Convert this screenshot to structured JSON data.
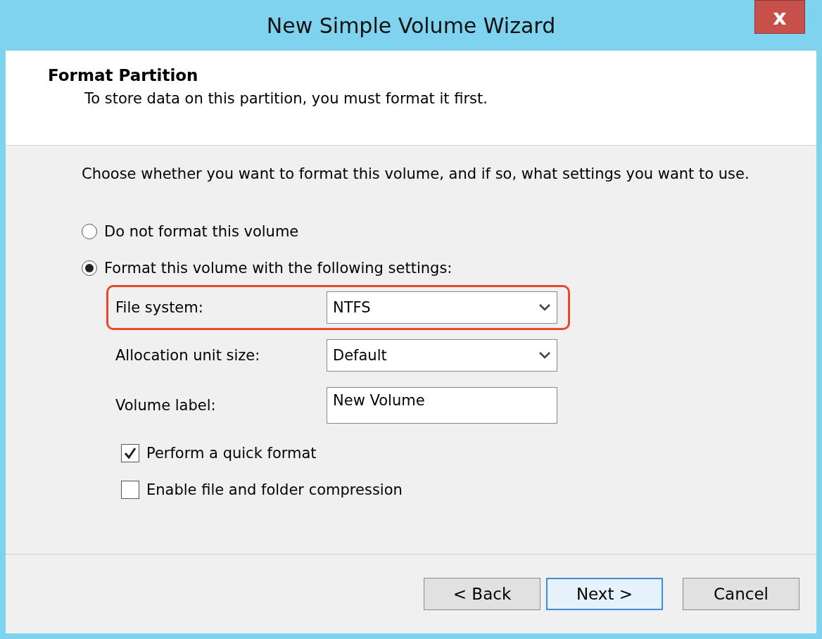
{
  "window": {
    "title": "New Simple Volume Wizard",
    "close": "x"
  },
  "header": {
    "title": "Format Partition",
    "subtitle": "To store data on this partition, you must format it first."
  },
  "instruction": "Choose whether you want to format this volume, and if so, what settings you want to use.",
  "options": [
    {
      "label": "Do not format this volume",
      "selected": false
    },
    {
      "label": "Format this volume with the following settings:",
      "selected": true
    }
  ],
  "settings": [
    {
      "kind": "dropdown",
      "label": "File system:",
      "value": "NTFS",
      "highlighted": true
    },
    {
      "kind": "dropdown",
      "label": "Allocation unit size:",
      "value": "Default",
      "highlighted": false
    },
    {
      "kind": "text",
      "label": "Volume label:",
      "value": "New Volume",
      "highlighted": false
    }
  ],
  "checkboxes": [
    {
      "label": "Perform a quick format",
      "checked": true
    },
    {
      "label": "Enable file and folder compression",
      "checked": false
    }
  ],
  "buttons": [
    {
      "label": "< Back",
      "focused": false
    },
    {
      "label": "Next >",
      "focused": true
    },
    {
      "label": "Cancel",
      "focused": false
    }
  ]
}
